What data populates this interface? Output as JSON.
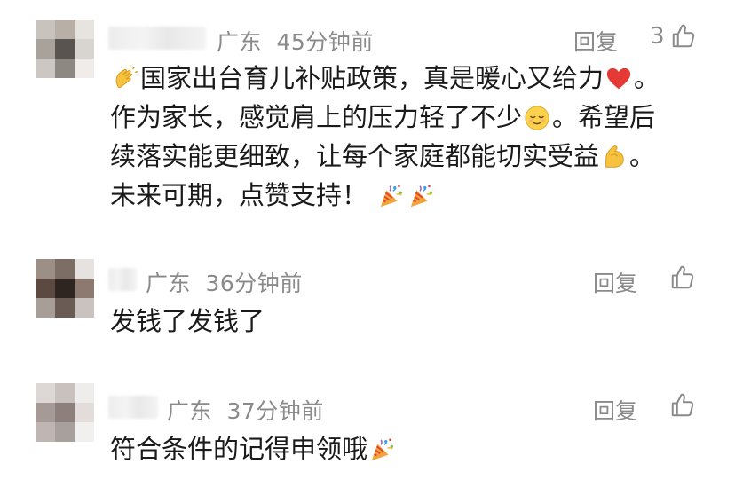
{
  "comments": [
    {
      "location": "广东",
      "time": "45分钟前",
      "reply_label": "回复",
      "like_count": "3",
      "lines": [
        "国家出台育儿补贴政策，真是暖心又给力",
        "。",
        "作为家长，感觉肩上的压力轻了不少",
        "。希望后",
        "续落实能更细致，让每个家庭都能切实受益",
        "。",
        "未来可期，点赞支持！"
      ],
      "emojis": [
        "clapping-hands-icon",
        "red-heart-icon",
        "relieved-face-icon",
        "flexed-biceps-icon",
        "party-popper-icon"
      ]
    },
    {
      "location": "广东",
      "time": "36分钟前",
      "reply_label": "回复",
      "text": "发钱了发钱了"
    },
    {
      "location": "广东",
      "time": "37分钟前",
      "reply_label": "回复",
      "text": "符合条件的记得申领哦",
      "emojis": [
        "party-popper-icon"
      ]
    }
  ],
  "colors": {
    "meta_gray": "#8a8a8a",
    "text": "#1a1a1a",
    "background": "#ffffff"
  }
}
